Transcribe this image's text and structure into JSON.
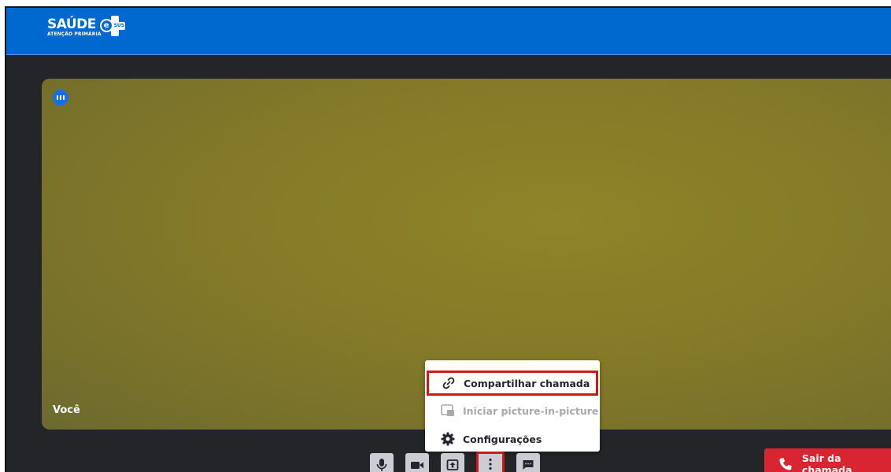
{
  "brand": {
    "name": "SAÚDE",
    "badge_letter": "e",
    "badge_text": "SUS",
    "subtitle": "ATENÇÃO PRIMÁRIA",
    "color": "#0069d0"
  },
  "video": {
    "participant_name": "Você",
    "speaker_indicator_icon": "audio-level-icon"
  },
  "menu": {
    "items": [
      {
        "label": "Compartilhar chamada",
        "icon": "link-icon",
        "state": "highlighted"
      },
      {
        "label": "Iniciar picture-in-picture",
        "icon": "picture-in-picture-icon",
        "state": "disabled"
      },
      {
        "label": "Configurações",
        "icon": "gear-icon",
        "state": "normal"
      }
    ]
  },
  "controls": [
    {
      "icon": "microphone-icon"
    },
    {
      "icon": "camera-icon"
    },
    {
      "icon": "share-screen-icon"
    },
    {
      "icon": "more-options-icon",
      "state": "selected"
    },
    {
      "icon": "chat-icon"
    }
  ],
  "leave": {
    "label": "Sair da chamada",
    "icon": "phone-icon",
    "color": "#d92432"
  },
  "colors": {
    "background": "#242529",
    "highlight_border": "#d01818"
  }
}
